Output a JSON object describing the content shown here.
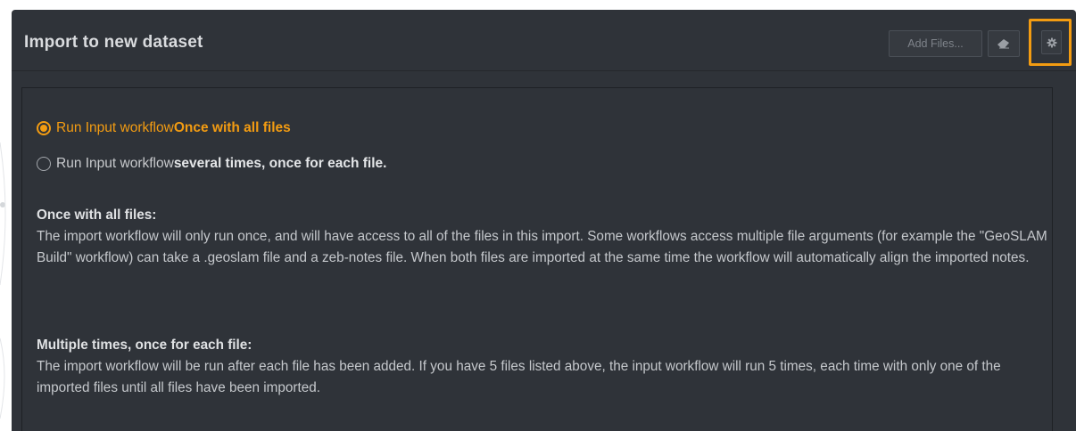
{
  "header": {
    "title": "Import to new dataset",
    "add_files_label": "Add Files...",
    "erase_icon": "eraser-icon",
    "settings_icon": "gear-icon"
  },
  "options": {
    "once": {
      "prefix": "Run Input workflow ",
      "emphasis": "Once with all files",
      "selected": true
    },
    "several": {
      "prefix": "Run Input workflow ",
      "emphasis": "several times, once for each file.",
      "selected": false
    }
  },
  "descriptions": {
    "once": {
      "heading": "Once with all files:",
      "body": "The import workflow will only run once, and will have access to all of the files in this import. Some workflows access multiple file arguments (for example the \"GeoSLAM Build\" workflow) can take a .geoslam file and a zeb-notes file. When both files are imported at the same time the workflow will automatically align the imported notes."
    },
    "multiple": {
      "heading": "Multiple times, once for each file:",
      "body": "The import workflow will be run after each file has been added. If you have 5 files listed above, the input workflow will run 5 times, each time with only one of the imported files until all files have been imported."
    }
  },
  "colors": {
    "accent": "#f39c12",
    "panel_bg": "#2f3339",
    "text": "#c5c8cc"
  }
}
